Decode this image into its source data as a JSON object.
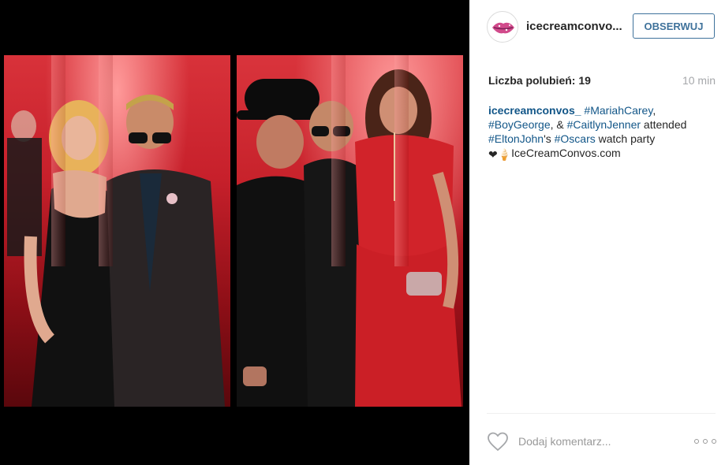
{
  "post": {
    "photos": [
      {
        "name": "photo-left"
      },
      {
        "name": "photo-right"
      }
    ]
  },
  "header": {
    "username": "icecreamconvo...",
    "follow_label": "OBSERWUJ",
    "avatar_icon": "lips-logo-icon"
  },
  "meta": {
    "likes": "Liczba polubień: 19",
    "time": "10 min"
  },
  "caption": {
    "user": "icecreamconvos_",
    "t1": " ",
    "tag1": "#MariahCarey",
    "t2": ",",
    "tag2": "#BoyGeorge",
    "t3": ", & ",
    "tag3": "#CaitlynJenner",
    "t4": " attended",
    "tag4": "#EltonJohn",
    "t5": "'s ",
    "tag5": "#Oscars",
    "t6": " watch party",
    "emoji": "❤🍦",
    "site": "IceCreamConvos.com"
  },
  "footer": {
    "comment_placeholder": "Dodaj komentarz...",
    "like_icon": "heart-icon",
    "more_icon": "more-options-icon"
  },
  "colors": {
    "link": "#125688",
    "follow": "#3f729b",
    "text": "#262626",
    "muted": "#a5a7aa"
  }
}
